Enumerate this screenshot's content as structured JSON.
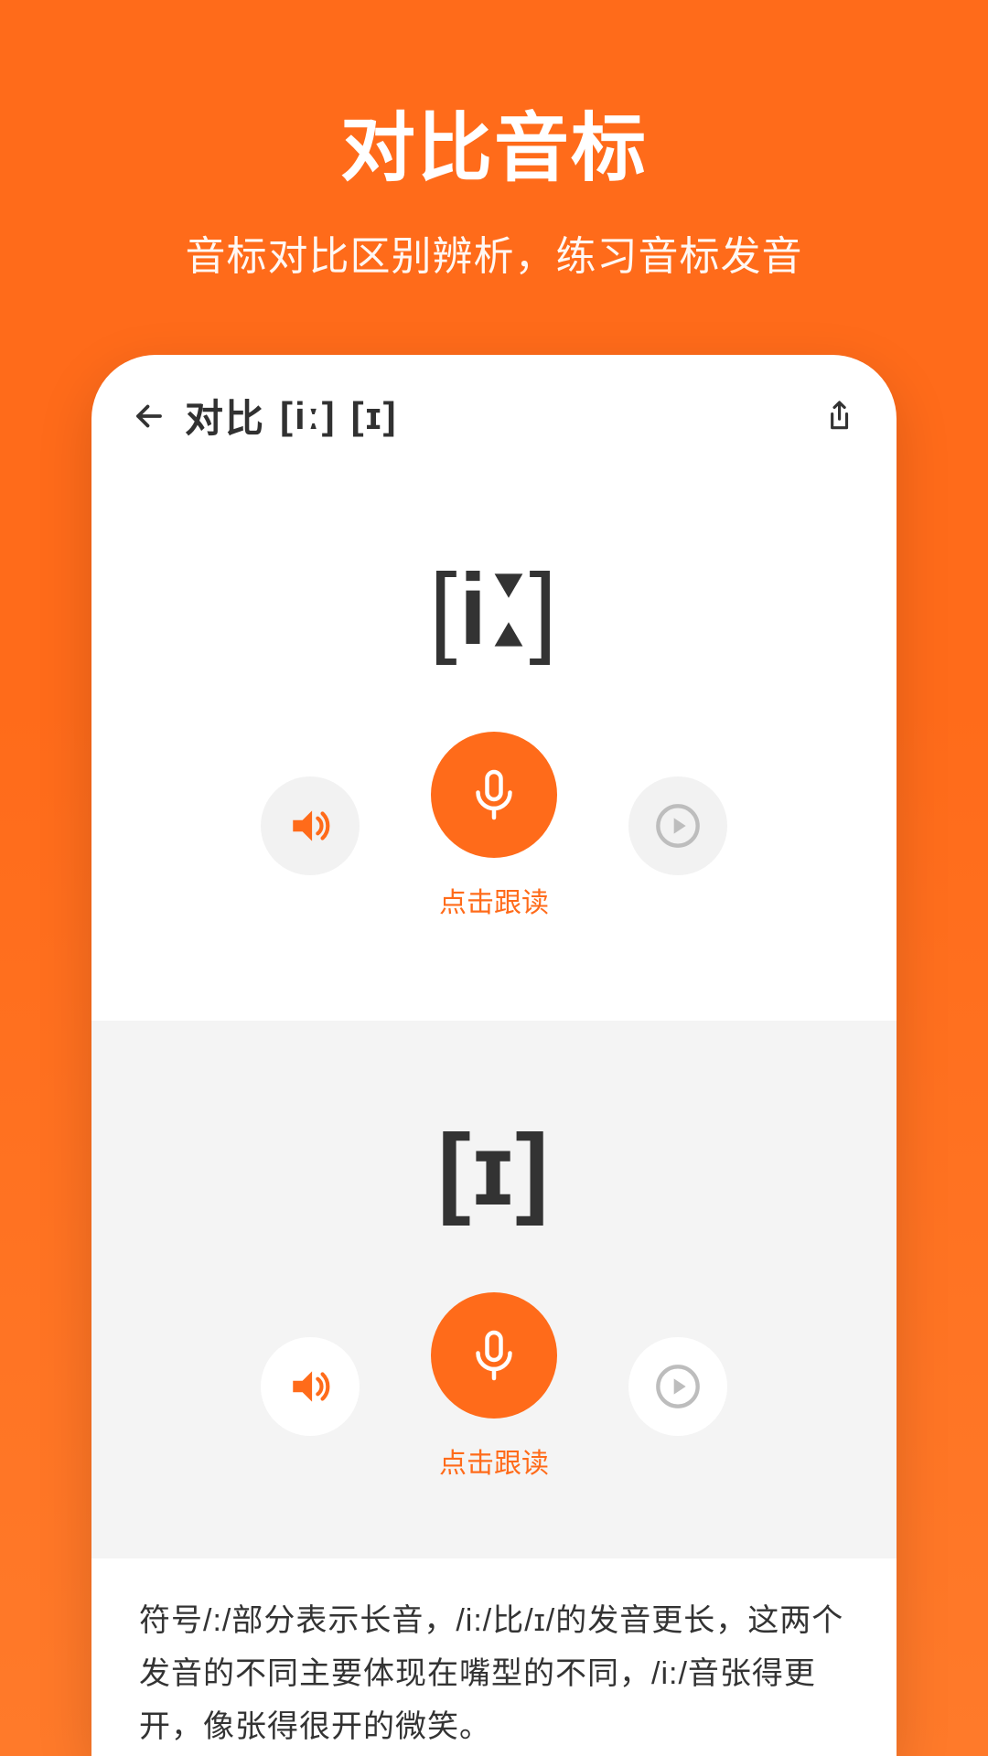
{
  "hero": {
    "title": "对比音标",
    "subtitle": "音标对比区别辨析，练习音标发音"
  },
  "appbar": {
    "title_prefix": "对比",
    "symbol1": "[iː]",
    "symbol2": "[ɪ]"
  },
  "cards": [
    {
      "phonetic": "[iː]",
      "mic_label": "点击跟读"
    },
    {
      "phonetic": "[ɪ]",
      "mic_label": "点击跟读"
    }
  ],
  "footer": "符号/:/部分表示长音，/i:/比/ɪ/的发音更长，这两个发音的不同主要体现在嘴型的不同，/i:/音张得更开，像张得很开的微笑。"
}
